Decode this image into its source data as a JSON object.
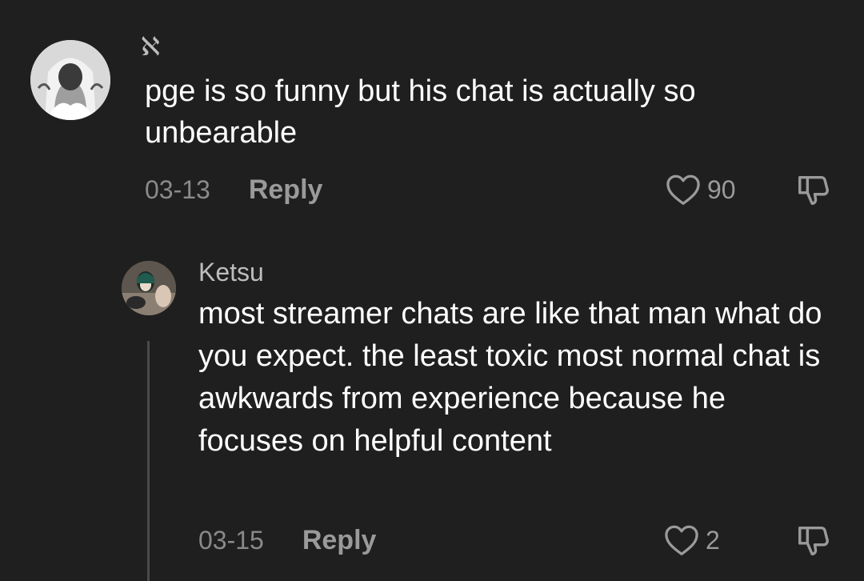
{
  "comment": {
    "username": "ℵ",
    "text": "pge is so funny but his chat is actually so unbearable",
    "date": "03-13",
    "reply_label": "Reply",
    "likes": "90"
  },
  "reply": {
    "username": "Ketsu",
    "text": "most streamer chats are like that man what do you expect. the least toxic most normal chat is awkwards from experience because he focuses on helpful content",
    "date": "03-15",
    "reply_label": "Reply",
    "likes": "2"
  },
  "colors": {
    "background": "#1f1f1f",
    "text": "#ffffff",
    "muted": "#8a8a8a",
    "icon": "#9a9a9a"
  },
  "icons": {
    "like": "heart-outline-icon",
    "dislike": "thumbs-down-outline-icon"
  }
}
